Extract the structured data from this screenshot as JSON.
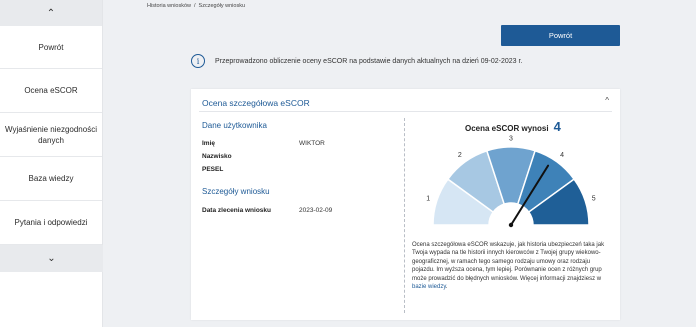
{
  "sidebar": {
    "up_arrow": "⌃",
    "down_arrow": "⌄",
    "items": [
      {
        "label": "Powrót"
      },
      {
        "label": "Ocena eSCOR"
      },
      {
        "label": "Wyjaśnienie niezgodności danych"
      },
      {
        "label": "Baza wiedzy"
      },
      {
        "label": "Pytania i odpowiedzi"
      }
    ]
  },
  "breadcrumb": {
    "items": [
      "Historia wniosków",
      "/",
      "Szczegóły wniosku"
    ]
  },
  "back_button": "Powrót",
  "info": {
    "icon": "info-icon",
    "glyph": "i",
    "text": "Przeprowadzono obliczenie oceny eSCOR na podstawie danych aktualnych na dzień 09-02-2023 r."
  },
  "card": {
    "title": "Ocena szczegółowa eSCOR",
    "chevron": "^",
    "user": {
      "title": "Dane użytkownika",
      "fields": [
        {
          "label": "Imię",
          "value": "WIKTOR"
        },
        {
          "label": "Nazwisko",
          "value": ""
        },
        {
          "label": "PESEL",
          "value": ""
        }
      ]
    },
    "request": {
      "title": "Szczegóły wniosku",
      "fields": [
        {
          "label": "Data zlecenia wniosku",
          "value": "2023-02-09"
        }
      ]
    },
    "escor": {
      "title": "Ocena eSCOR wynosi",
      "score": "4",
      "gauge": {
        "labels": [
          "1",
          "2",
          "3",
          "4",
          "5"
        ],
        "value": 4,
        "colors": [
          "#d6e6f4",
          "#a7c8e3",
          "#6fa3cf",
          "#3e82b8",
          "#1f5f97"
        ]
      }
    },
    "description": {
      "text": "Ocena szczegółowa eSCOR wskazuje, jak historia ubezpieczeń taka jak Twoja wypada na tle historii innych kierowców z Twojej grupy wiekowo-geograficznej, w ramach tego samego rodzaju umowy oraz rodzaju pojazdu. Im wyższa ocena, tym lepiej. Porównanie ocen z różnych grup może prowadzić do błędnych wniosków. Więcej informacji znajdziesz w",
      "link": "bazie wiedzy",
      "end": "."
    }
  }
}
